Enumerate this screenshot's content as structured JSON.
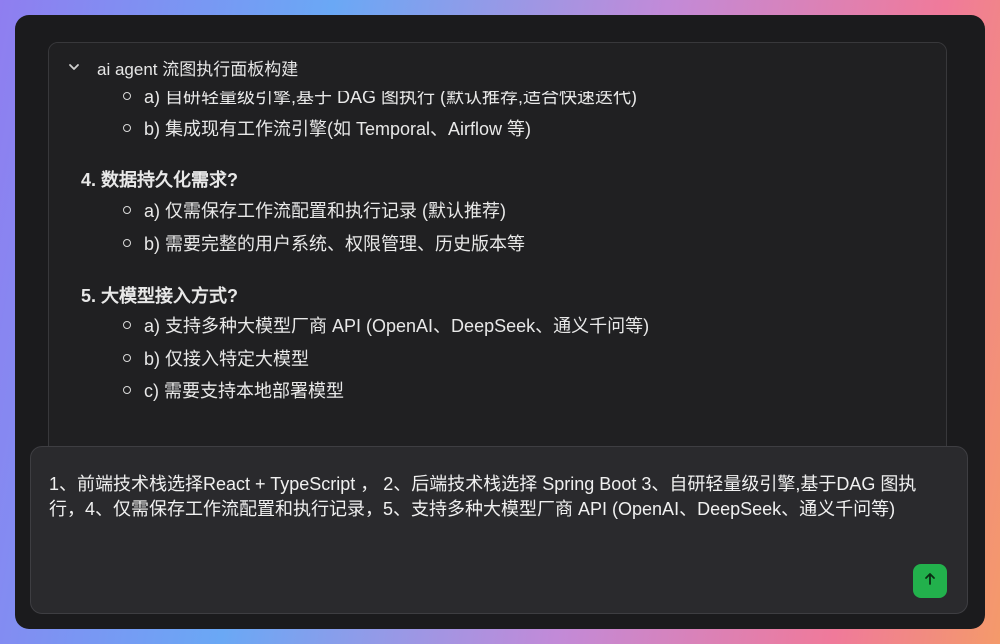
{
  "panel": {
    "title": "ai agent 流图执行面板构建",
    "icon": "chevron-down-icon"
  },
  "content": {
    "items": [
      {
        "type": "option",
        "text": "a) 自研轻量级引擎,基于 DAG 图执行 (默认推荐,适合快速迭代)"
      },
      {
        "type": "option",
        "text": "b) 集成现有工作流引擎(如 Temporal、Airflow 等)"
      },
      {
        "type": "question",
        "text": "4. 数据持久化需求?"
      },
      {
        "type": "option",
        "text": "a) 仅需保存工作流配置和执行记录 (默认推荐)"
      },
      {
        "type": "option",
        "text": "b) 需要完整的用户系统、权限管理、历史版本等"
      },
      {
        "type": "question",
        "text": "5. 大模型接入方式?"
      },
      {
        "type": "option",
        "text": "a) 支持多种大模型厂商 API (OpenAI、DeepSeek、通义千问等)"
      },
      {
        "type": "option",
        "text": "b) 仅接入特定大模型"
      },
      {
        "type": "option",
        "text": "c) 需要支持本地部署模型"
      }
    ]
  },
  "composer": {
    "text": "1、前端技术栈选择React + TypeScript ， 2、后端技术栈选择 Spring Boot 3、自研轻量级引擎,基于DAG 图执行，4、仅需保存工作流配置和执行记录，5、支持多种大模型厂商 API (OpenAI、DeepSeek、通义千问等)",
    "send_icon": "arrow-up-icon",
    "send_color": "#22b14c"
  }
}
